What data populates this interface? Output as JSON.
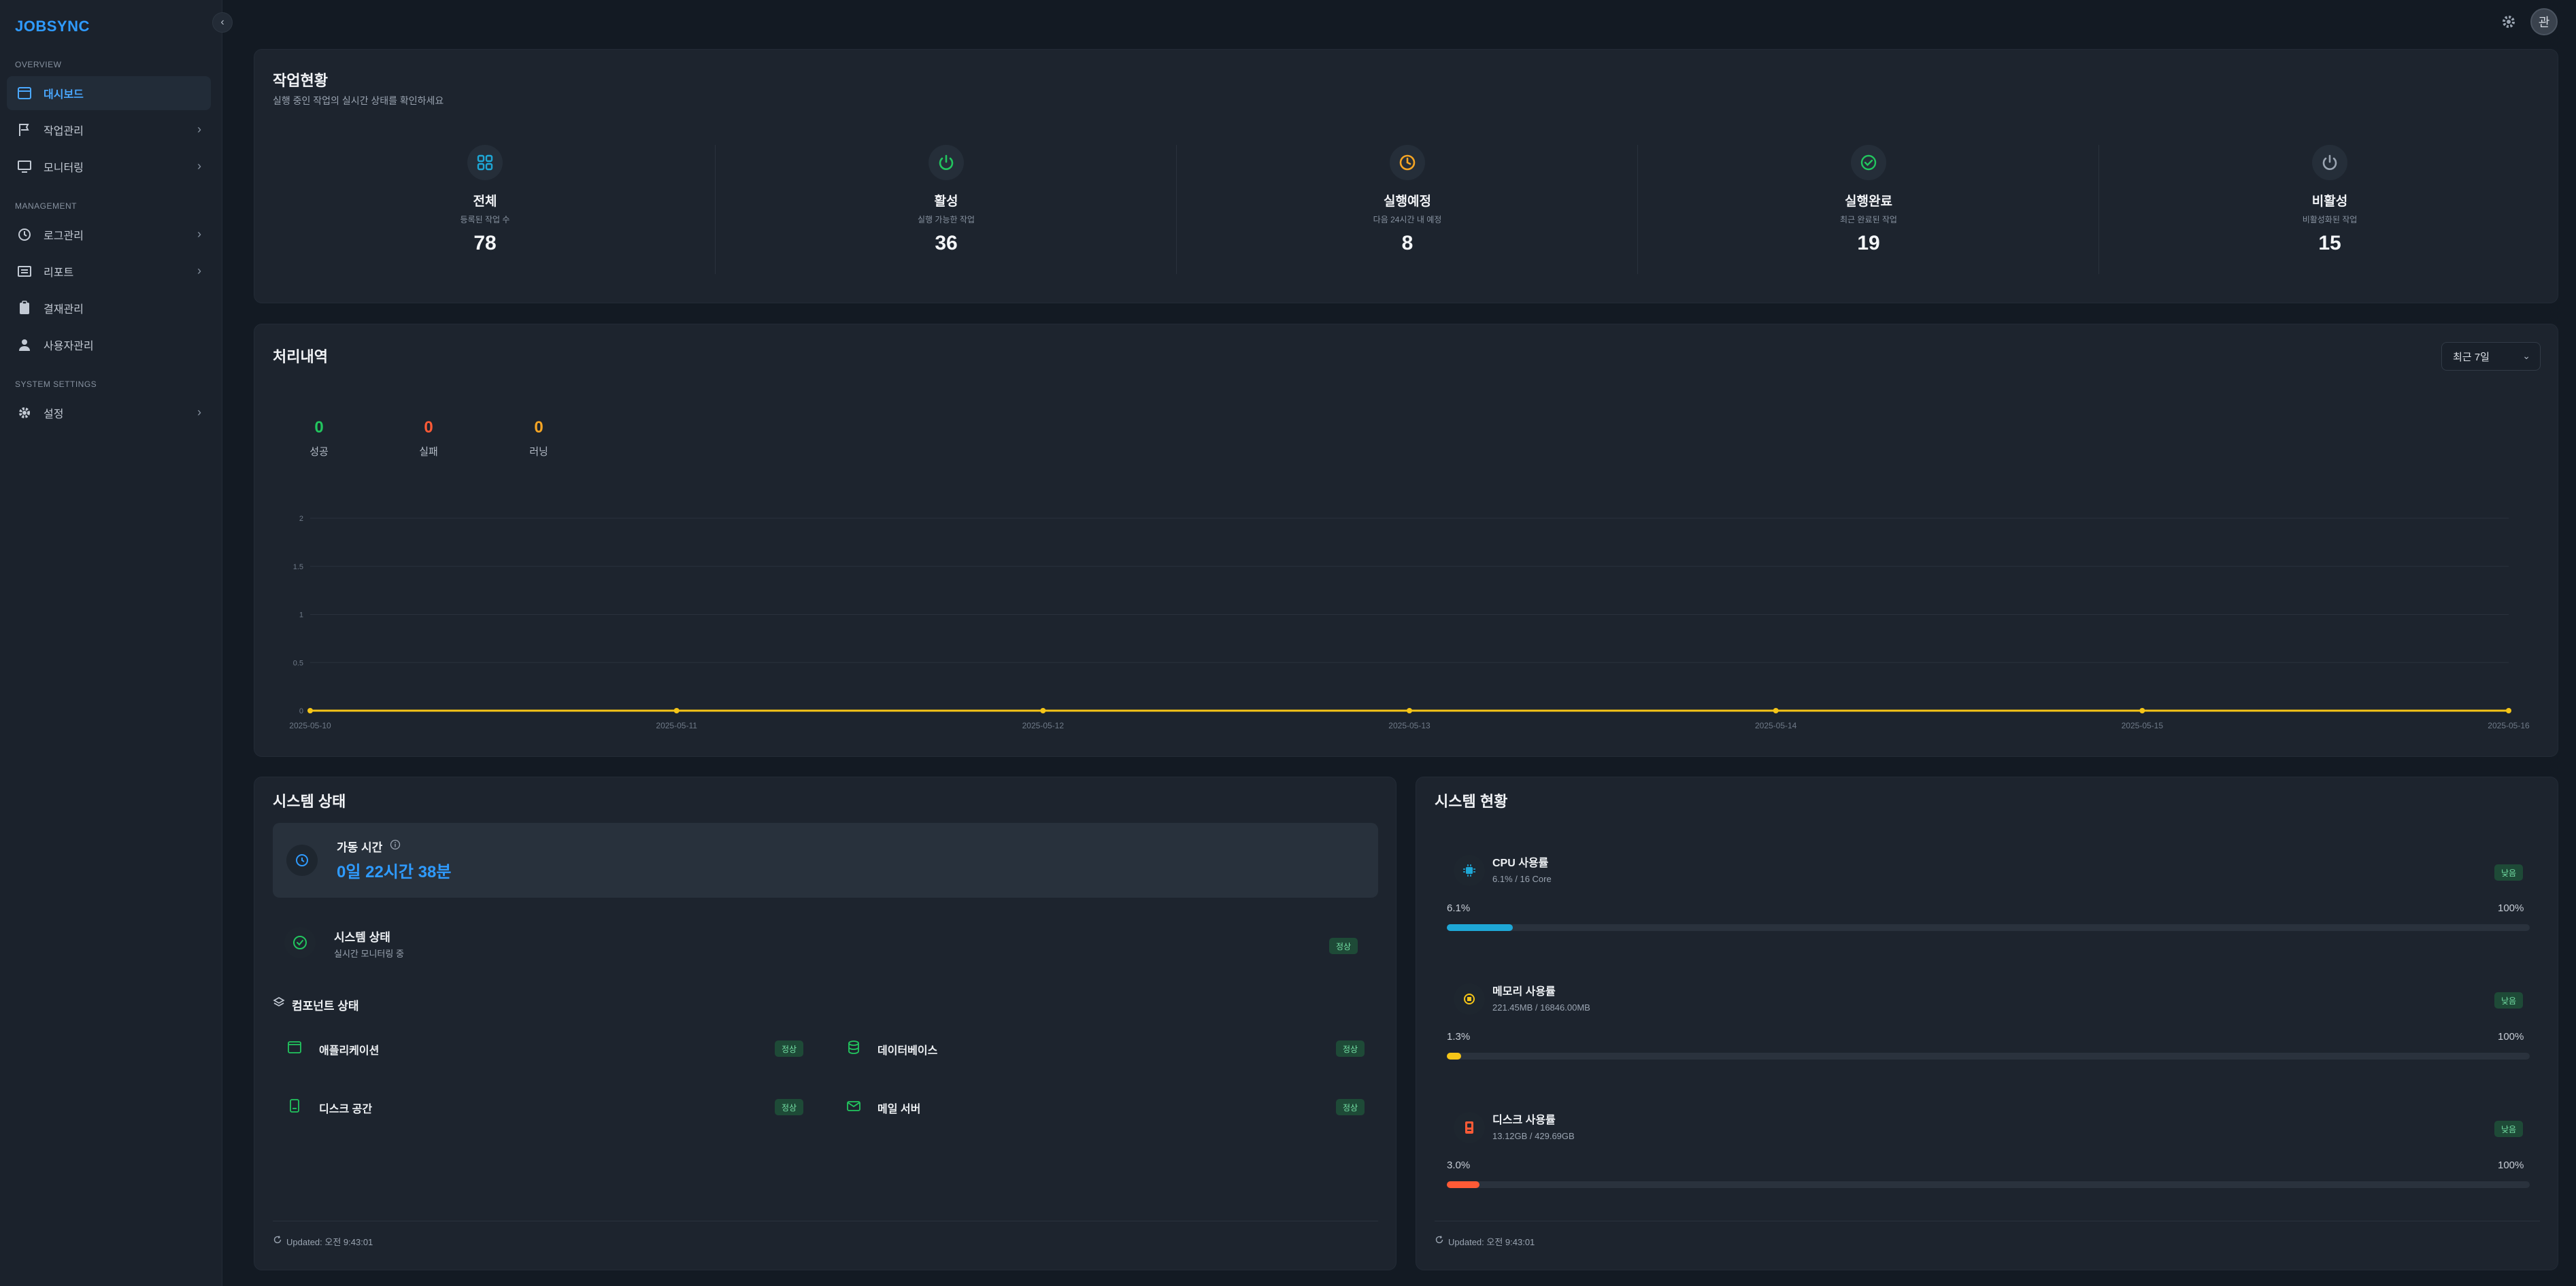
{
  "sidebar": {
    "logo": "JOBSYNC",
    "collapse": "‹",
    "sections": {
      "overview": "OVERVIEW",
      "management": "MANAGEMENT",
      "system": "SYSTEM SETTINGS"
    },
    "items": {
      "dashboard": "대시보드",
      "jobs": "작업관리",
      "monitoring": "모니터링",
      "logs": "로그관리",
      "reports": "리포트",
      "approvals": "결재관리",
      "users": "사용자관리",
      "settings": "설정"
    }
  },
  "header": {
    "avatar": "관"
  },
  "job_status": {
    "title": "작업현황",
    "subtitle": "실행 중인 작업의 실시간 상태를 확인하세요",
    "stats": [
      {
        "label": "전체",
        "sub": "등록된 작업 수",
        "value": "78",
        "icon": "grid-icon",
        "color": "#1ea7d6"
      },
      {
        "label": "활성",
        "sub": "실행 가능한 작업",
        "value": "36",
        "icon": "power-icon",
        "color": "#22c55e"
      },
      {
        "label": "실행예정",
        "sub": "다음 24시간 내 예정",
        "value": "8",
        "icon": "clock-icon",
        "color": "#f5a524"
      },
      {
        "label": "실행완료",
        "sub": "최근 완료된 작업",
        "value": "19",
        "icon": "check-circle-icon",
        "color": "#22c55e"
      },
      {
        "label": "비활성",
        "sub": "비활성화된 작업",
        "value": "15",
        "icon": "power-off-icon",
        "color": "#9aa4b1"
      }
    ]
  },
  "processing": {
    "title": "처리내역",
    "period": "최근 7일",
    "summary": [
      {
        "value": "0",
        "label": "성공",
        "color": "#22c55e"
      },
      {
        "value": "0",
        "label": "실패",
        "color": "#ff5a36"
      },
      {
        "value": "0",
        "label": "러닝",
        "color": "#f5a524"
      }
    ]
  },
  "chart_data": {
    "type": "line",
    "x": [
      "2025-05-10",
      "2025-05-11",
      "2025-05-12",
      "2025-05-13",
      "2025-05-14",
      "2025-05-15",
      "2025-05-16"
    ],
    "series": [
      {
        "values": [
          0,
          0,
          0,
          0,
          0,
          0,
          0
        ],
        "color": "#f5c518"
      }
    ],
    "y_ticks": [
      "0",
      "0.5",
      "1",
      "1.5",
      "2"
    ],
    "ylim": [
      0,
      2
    ],
    "grid": true
  },
  "system_state": {
    "title": "시스템 상태",
    "uptime_label": "가동 시간",
    "uptime_value": "0일 22시간 38분",
    "status_title": "시스템 상태",
    "status_sub": "실시간 모니터링 중",
    "status_badge": "정상",
    "components_title": "컴포넌트 상태",
    "components": [
      {
        "name": "애플리케이션",
        "status": "정상"
      },
      {
        "name": "데이터베이스",
        "status": "정상"
      },
      {
        "name": "디스크 공간",
        "status": "정상"
      },
      {
        "name": "메일 서버",
        "status": "정상"
      }
    ],
    "updated": "Updated: 오전 9:43:01"
  },
  "system_resources": {
    "title": "시스템 현황",
    "items": [
      {
        "title": "CPU 사용률",
        "sub": "6.1% / 16 Core",
        "badge": "낮음",
        "pct_label": "6.1%",
        "max_label": "100%",
        "fraction": 0.061,
        "color": "#1ea7d6",
        "icon": "cpu-icon"
      },
      {
        "title": "메모리 사용률",
        "sub": "221.45MB / 16846.00MB",
        "badge": "낮음",
        "pct_label": "1.3%",
        "max_label": "100%",
        "fraction": 0.013,
        "color": "#f5c518",
        "icon": "memory-icon"
      },
      {
        "title": "디스크 사용률",
        "sub": "13.12GB / 429.69GB",
        "badge": "낮음",
        "pct_label": "3.0%",
        "max_label": "100%",
        "fraction": 0.03,
        "color": "#ff5a36",
        "icon": "disk-icon"
      }
    ],
    "updated": "Updated: 오전 9:43:01"
  }
}
